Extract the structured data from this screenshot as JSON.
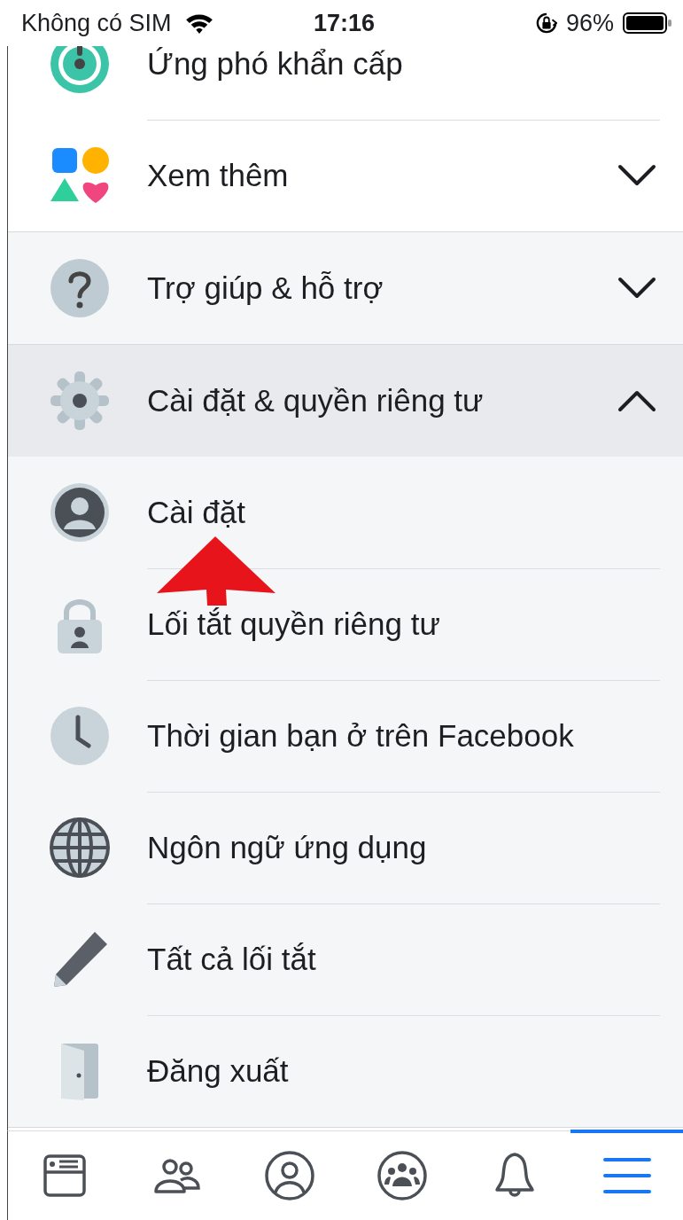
{
  "status_bar": {
    "carrier": "Không có SIM",
    "time": "17:16",
    "battery": "96%"
  },
  "menu": [
    {
      "label": "Ứng phó khẩn cấp",
      "kind": "crisis"
    },
    {
      "label": "Xem thêm",
      "kind": "more",
      "expanded": false
    }
  ],
  "sections": [
    {
      "label": "Trợ giúp & hỗ trợ",
      "kind": "help",
      "expanded": false
    },
    {
      "label": "Cài đặt & quyền riêng tư",
      "kind": "gear",
      "expanded": true,
      "children": [
        {
          "label": "Cài đặt",
          "kind": "person"
        },
        {
          "label": "Lối tắt quyền riêng tư",
          "kind": "lock"
        },
        {
          "label": "Thời gian bạn ở trên Facebook",
          "kind": "clock"
        },
        {
          "label": "Ngôn ngữ ứng dụng",
          "kind": "globe"
        },
        {
          "label": "Tất cả lối tắt",
          "kind": "pencil"
        },
        {
          "label": "Đăng xuất",
          "kind": "door"
        }
      ]
    }
  ],
  "tab_bar": [
    {
      "kind": "news",
      "selected": false
    },
    {
      "kind": "friends",
      "selected": false
    },
    {
      "kind": "profile",
      "selected": false
    },
    {
      "kind": "groups",
      "selected": false
    },
    {
      "kind": "bell",
      "selected": false
    },
    {
      "kind": "menu",
      "selected": true
    }
  ]
}
